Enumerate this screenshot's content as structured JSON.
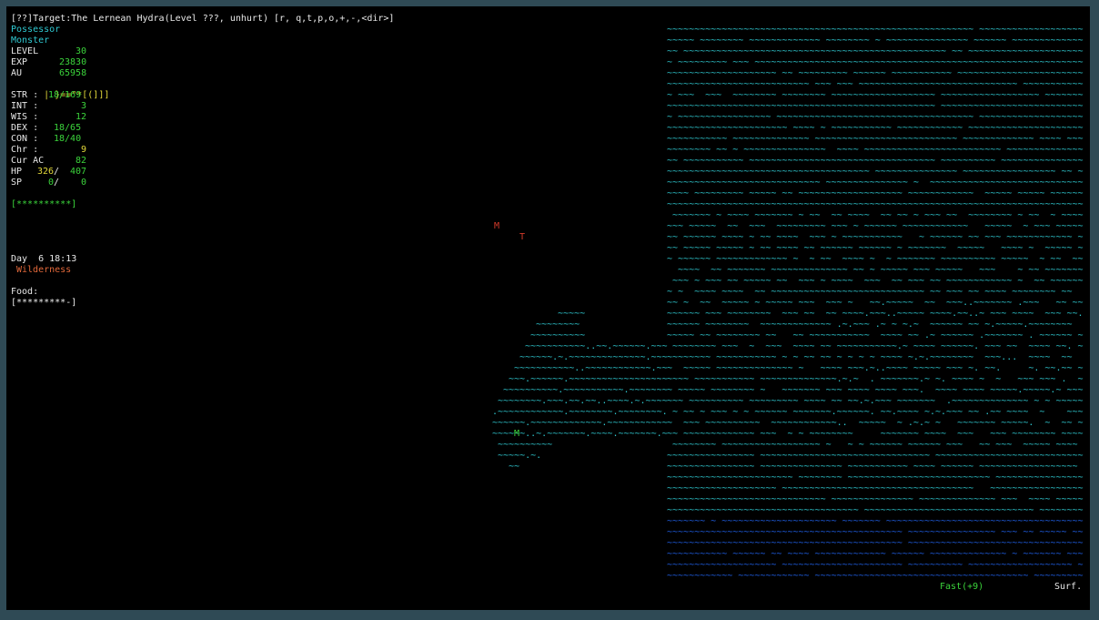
{
  "top_message": "[??]Target:The Lernean Hydra(Level ???, unhurt) [r, q,t,p,o,+,-,<dir>]",
  "sidebar": {
    "race": "Possessor",
    "class": "Monster",
    "level_label": "LEVEL",
    "level_value": "30",
    "exp_label": "EXP",
    "exp_value": "23830",
    "au_label": "AU",
    "au_value": "65958",
    "equip_glyphs": "| }==\"*[(]]]",
    "str_label": "STR :",
    "str_value": "18/169",
    "int_label": "INT :",
    "int_value": "3",
    "wis_label": "WIS :",
    "wis_value": "12",
    "dex_label": "DEX :",
    "dex_value": "18/65",
    "con_label": "CON :",
    "con_value": "18/40",
    "chr_label": "Chr :",
    "chr_value": "9",
    "ac_label": "Cur AC",
    "ac_value": "82",
    "hp_label": "HP",
    "hp_cur": "326",
    "hp_sep": "/",
    "hp_max": "407",
    "sp_label": "SP",
    "sp_cur": "0",
    "sp_sep": "/",
    "sp_max": "0",
    "health_bar": "[**********]",
    "day_time": "Day  6 18:13",
    "location": "Wilderness",
    "food_label": "Food:",
    "food_bar": "[*********-]"
  },
  "status_bar": {
    "speed": "Fast(+9)",
    "terrain": "Surf."
  },
  "map_glyphs": {
    "monster_m_red": "M",
    "monster_t": "T",
    "player": "M",
    "water": "~",
    "floor": "."
  },
  "colors": {
    "background": "#000000",
    "frame": "#2f4a55",
    "water_light": "#2fc8d0",
    "water_deep": "#2060e8",
    "text": "#e8e8e8",
    "value": "#3bd43b",
    "warning": "#e2d83a",
    "hostile": "#d23a2a"
  }
}
